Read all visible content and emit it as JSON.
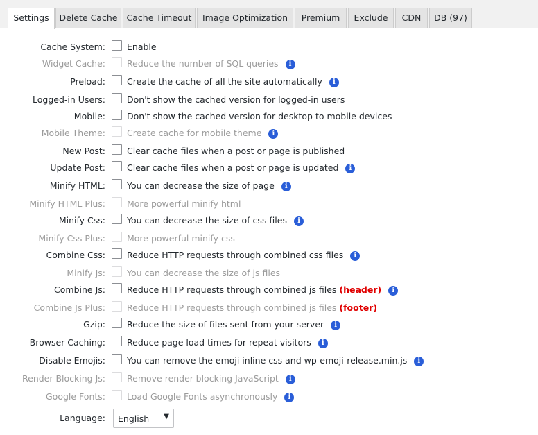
{
  "tabs": [
    "Settings",
    "Delete Cache",
    "Cache Timeout",
    "Image Optimization",
    "Premium",
    "Exclude",
    "CDN",
    "DB (97)"
  ],
  "rows": [
    {
      "label": "Cache System:",
      "desc": "Enable",
      "info": false,
      "disabled": false
    },
    {
      "label": "Widget Cache:",
      "desc": "Reduce the number of SQL queries",
      "info": true,
      "disabled": true
    },
    {
      "label": "Preload:",
      "desc": "Create the cache of all the site automatically",
      "info": true,
      "disabled": false
    },
    {
      "label": "Logged-in Users:",
      "desc": "Don't show the cached version for logged-in users",
      "info": false,
      "disabled": false
    },
    {
      "label": "Mobile:",
      "desc": "Don't show the cached version for desktop to mobile devices",
      "info": false,
      "disabled": false
    },
    {
      "label": "Mobile Theme:",
      "desc": "Create cache for mobile theme",
      "info": true,
      "disabled": true
    },
    {
      "label": "New Post:",
      "desc": "Clear cache files when a post or page is published",
      "info": false,
      "disabled": false
    },
    {
      "label": "Update Post:",
      "desc": "Clear cache files when a post or page is updated",
      "info": true,
      "disabled": false
    },
    {
      "label": "Minify HTML:",
      "desc": "You can decrease the size of page",
      "info": true,
      "disabled": false
    },
    {
      "label": "Minify HTML Plus:",
      "desc": "More powerful minify html",
      "info": false,
      "disabled": true
    },
    {
      "label": "Minify Css:",
      "desc": "You can decrease the size of css files",
      "info": true,
      "disabled": false
    },
    {
      "label": "Minify Css Plus:",
      "desc": "More powerful minify css",
      "info": false,
      "disabled": true
    },
    {
      "label": "Combine Css:",
      "desc": "Reduce HTTP requests through combined css files",
      "info": true,
      "disabled": false
    },
    {
      "label": "Minify Js:",
      "desc": "You can decrease the size of js files",
      "info": false,
      "disabled": true
    },
    {
      "label": "Combine Js:",
      "desc": "Reduce HTTP requests through combined js files",
      "tag": "(header)",
      "info": true,
      "disabled": false
    },
    {
      "label": "Combine Js Plus:",
      "desc": "Reduce HTTP requests through combined js files",
      "tag": "(footer)",
      "info": false,
      "disabled": true
    },
    {
      "label": "Gzip:",
      "desc": "Reduce the size of files sent from your server",
      "info": true,
      "disabled": false
    },
    {
      "label": "Browser Caching:",
      "desc": "Reduce page load times for repeat visitors",
      "info": true,
      "disabled": false
    },
    {
      "label": "Disable Emojis:",
      "desc": "You can remove the emoji inline css and wp-emoji-release.min.js",
      "info": true,
      "disabled": false
    },
    {
      "label": "Render Blocking Js:",
      "desc": "Remove render-blocking JavaScript",
      "info": true,
      "disabled": true
    },
    {
      "label": "Google Fonts:",
      "desc": "Load Google Fonts asynchronously",
      "info": true,
      "disabled": true
    }
  ],
  "language": {
    "label": "Language:",
    "value": "English"
  },
  "icons": {
    "info": "info-icon",
    "dropdown": "chevron-down-icon"
  },
  "colors": {
    "info": "#2a5ed8",
    "tag": "#e00000",
    "disabled_text": "#9b9b9b"
  }
}
